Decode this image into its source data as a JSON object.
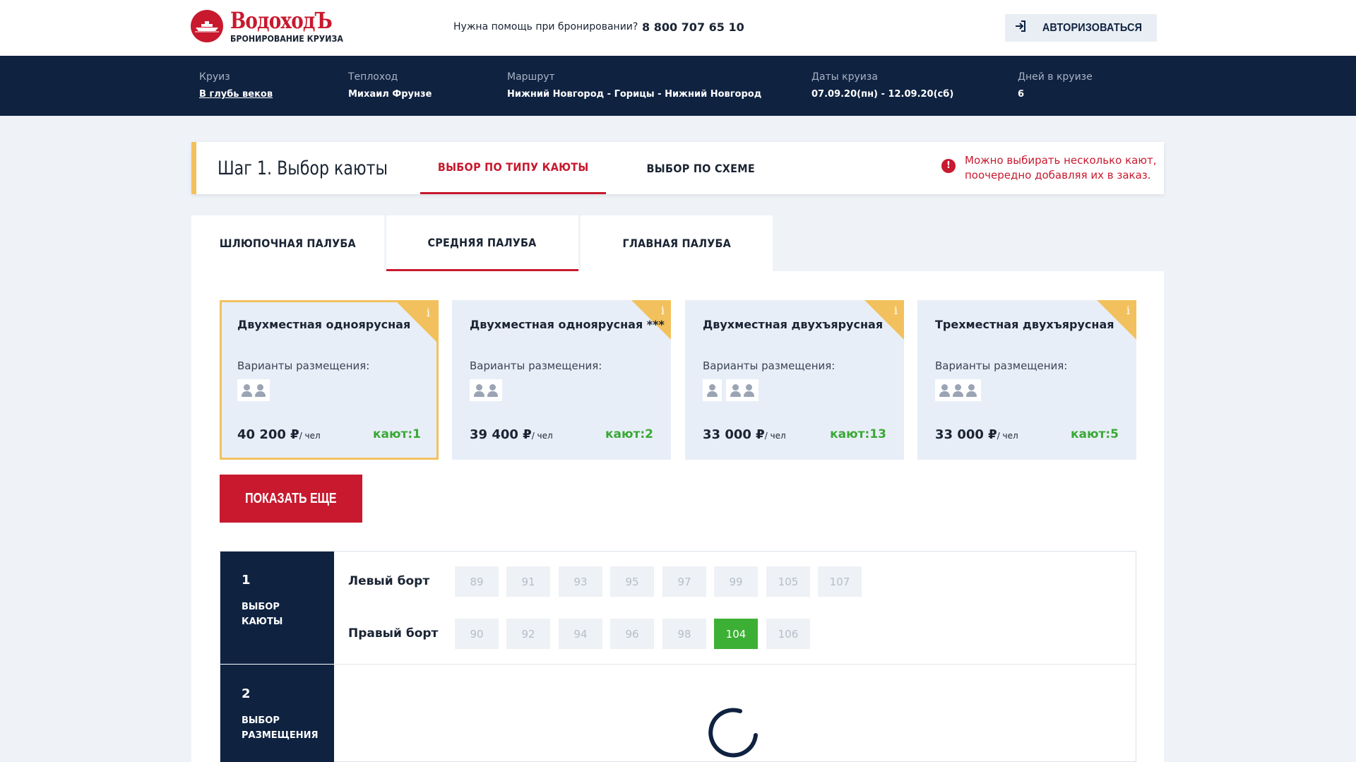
{
  "header": {
    "brand": "ВодоходЪ",
    "brand_sub": "БРОНИРОВАНИЕ КРУИЗА",
    "help_text": "Нужна помощь при бронировании?",
    "phone": "8 800 707 65 10",
    "login_label": "АВТОРИЗОВАТЬСЯ",
    "login_icon": "login-arrow-icon"
  },
  "cruise": {
    "cruise_label": "Круиз",
    "cruise_value": "В глубь веков",
    "ship_label": "Теплоход",
    "ship_value": "Михаил Фрунзе",
    "route_label": "Маршрут",
    "route_value": "Нижний Новгород - Горицы - Нижний Новгород",
    "dates_label": "Даты круиза",
    "dates_value": "07.09.20(пн) - 12.09.20(сб)",
    "days_label": "Дней в круизе",
    "days_value": "6"
  },
  "step": {
    "title": "Шаг 1. Выбор каюты",
    "tab_type": "ВЫБОР ПО ТИПУ КАЮТЫ",
    "tab_scheme": "ВЫБОР ПО СХЕМЕ",
    "active_tab": "ВЫБОР ПО ТИПУ КАЮТЫ",
    "note": "Можно выбирать несколько кают, поочередно добавляя их в заказ.",
    "note_icon": "!"
  },
  "decks": {
    "tabs": [
      "ШЛЮПОЧНАЯ ПАЛУБА",
      "СРЕДНЯЯ ПАЛУБА",
      "ГЛАВНАЯ ПАЛУБА"
    ],
    "active": "СРЕДНЯЯ ПАЛУБА"
  },
  "cards": [
    {
      "title": "Двухместная одноярусная",
      "sub": "Варианты размещения:",
      "price": "40 200 ₽",
      "per": "/ чел",
      "count": "кают:1",
      "info": "i",
      "persons": [
        2
      ],
      "selected": true
    },
    {
      "title": "Двухместная одноярусная ***",
      "sub": "Варианты размещения:",
      "price": "39 400 ₽",
      "per": "/ чел",
      "count": "кают:2",
      "info": "i",
      "persons": [
        2
      ],
      "selected": false
    },
    {
      "title": "Двухместная двухъярусная",
      "sub": "Варианты размещения:",
      "price": "33 000 ₽",
      "per": "/ чел",
      "count": "кают:13",
      "info": "i",
      "persons": [
        1,
        2
      ],
      "selected": false
    },
    {
      "title": "Трехместная двухъярусная",
      "sub": "Варианты размещения:",
      "price": "33 000 ₽",
      "per": "/ чел",
      "count": "кают:5",
      "info": "i",
      "persons": [
        3
      ],
      "selected": false
    }
  ],
  "show_more": "ПОКАЗАТЬ ЕЩЕ",
  "picker": {
    "step1_num": "1",
    "step1_label": "ВЫБОР КАЮТЫ",
    "step2_num": "2",
    "step2_label": "ВЫБОР РАЗМЕЩЕНИЯ",
    "left_label": "Левый борт",
    "right_label": "Правый борт",
    "left_cabins": [
      "89",
      "91",
      "93",
      "95",
      "97",
      "99",
      "105",
      "107"
    ],
    "right_cabins": [
      "90",
      "92",
      "94",
      "96",
      "98",
      "104",
      "106"
    ],
    "available": [
      "104"
    ]
  },
  "colors": {
    "brand_red": "#c8192e",
    "navy": "#0f2240",
    "accent_yellow": "#f2c15e",
    "available_green": "#3cb034"
  }
}
